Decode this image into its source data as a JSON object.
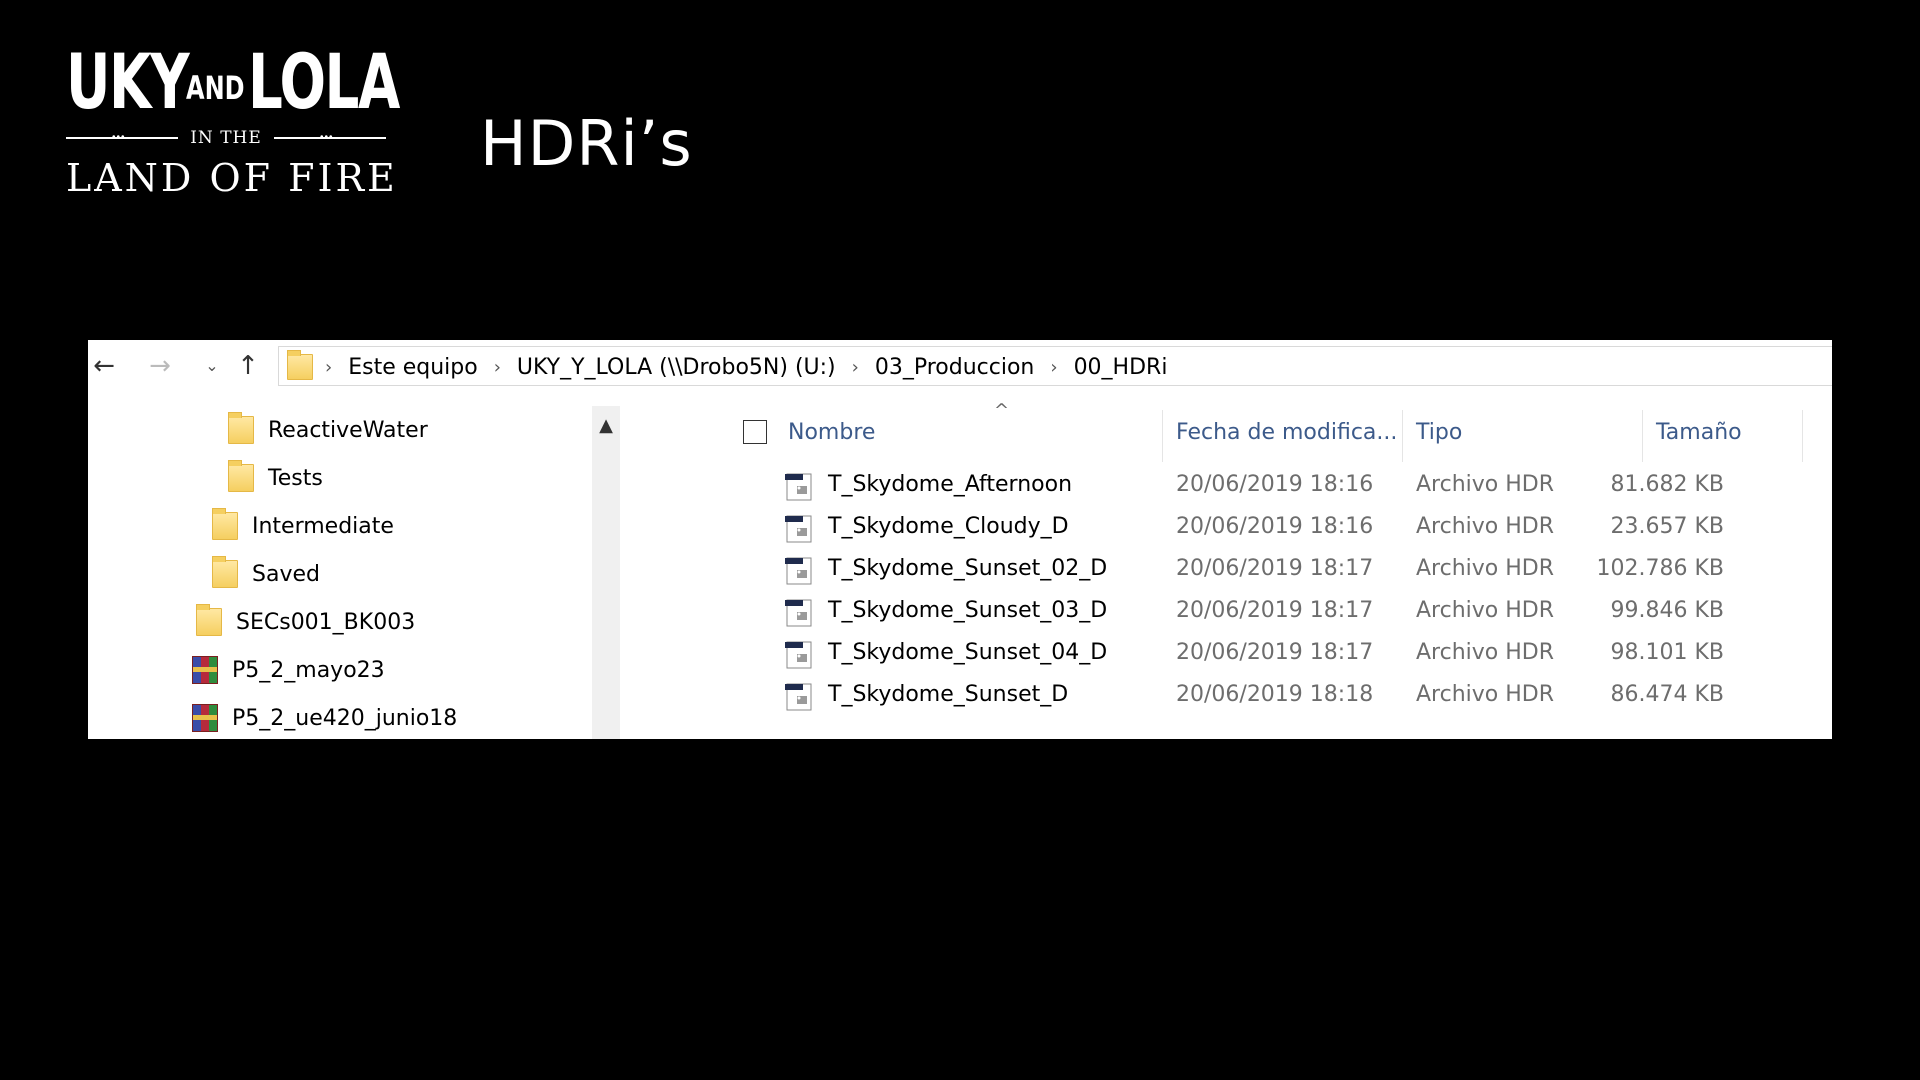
{
  "logo": {
    "uky": "UKY",
    "and": "AND",
    "lola": "LOLA",
    "in_the": "IN THE",
    "land_of_fire": "LAND OF FIRE"
  },
  "slide_title": "HDRi’s",
  "explorer": {
    "nav": {
      "back": "←",
      "forward": "→",
      "recent": "⌄",
      "up": "↑"
    },
    "breadcrumb": [
      "Este equipo",
      "UKY_Y_LOLA (\\\\Drobo5N) (U:)",
      "03_Produccion",
      "00_HDRi"
    ],
    "tree": [
      {
        "label": "ReactiveWater",
        "icon": "folder-icon"
      },
      {
        "label": "Tests",
        "icon": "folder-icon"
      },
      {
        "label": "Intermediate",
        "icon": "folder-icon"
      },
      {
        "label": "Saved",
        "icon": "folder-icon"
      },
      {
        "label": "SECs001_BK003",
        "icon": "folder-icon"
      },
      {
        "label": "P5_2_mayo23",
        "icon": "rar-archive-icon"
      },
      {
        "label": "P5_2_ue420_junio18",
        "icon": "rar-archive-icon"
      }
    ],
    "columns": {
      "name": "Nombre",
      "date": "Fecha de modifica...",
      "type": "Tipo",
      "size": "Tamaño"
    },
    "files": [
      {
        "name": "T_Skydome_Afternoon",
        "date": "20/06/2019 18:16",
        "type": "Archivo HDR",
        "size": "81.682 KB"
      },
      {
        "name": "T_Skydome_Cloudy_D",
        "date": "20/06/2019 18:16",
        "type": "Archivo HDR",
        "size": "23.657 KB"
      },
      {
        "name": "T_Skydome_Sunset_02_D",
        "date": "20/06/2019 18:17",
        "type": "Archivo HDR",
        "size": "102.786 KB"
      },
      {
        "name": "T_Skydome_Sunset_03_D",
        "date": "20/06/2019 18:17",
        "type": "Archivo HDR",
        "size": "99.846 KB"
      },
      {
        "name": "T_Skydome_Sunset_04_D",
        "date": "20/06/2019 18:17",
        "type": "Archivo HDR",
        "size": "98.101 KB"
      },
      {
        "name": "T_Skydome_Sunset_D",
        "date": "20/06/2019 18:18",
        "type": "Archivo HDR",
        "size": "86.474 KB"
      }
    ]
  }
}
